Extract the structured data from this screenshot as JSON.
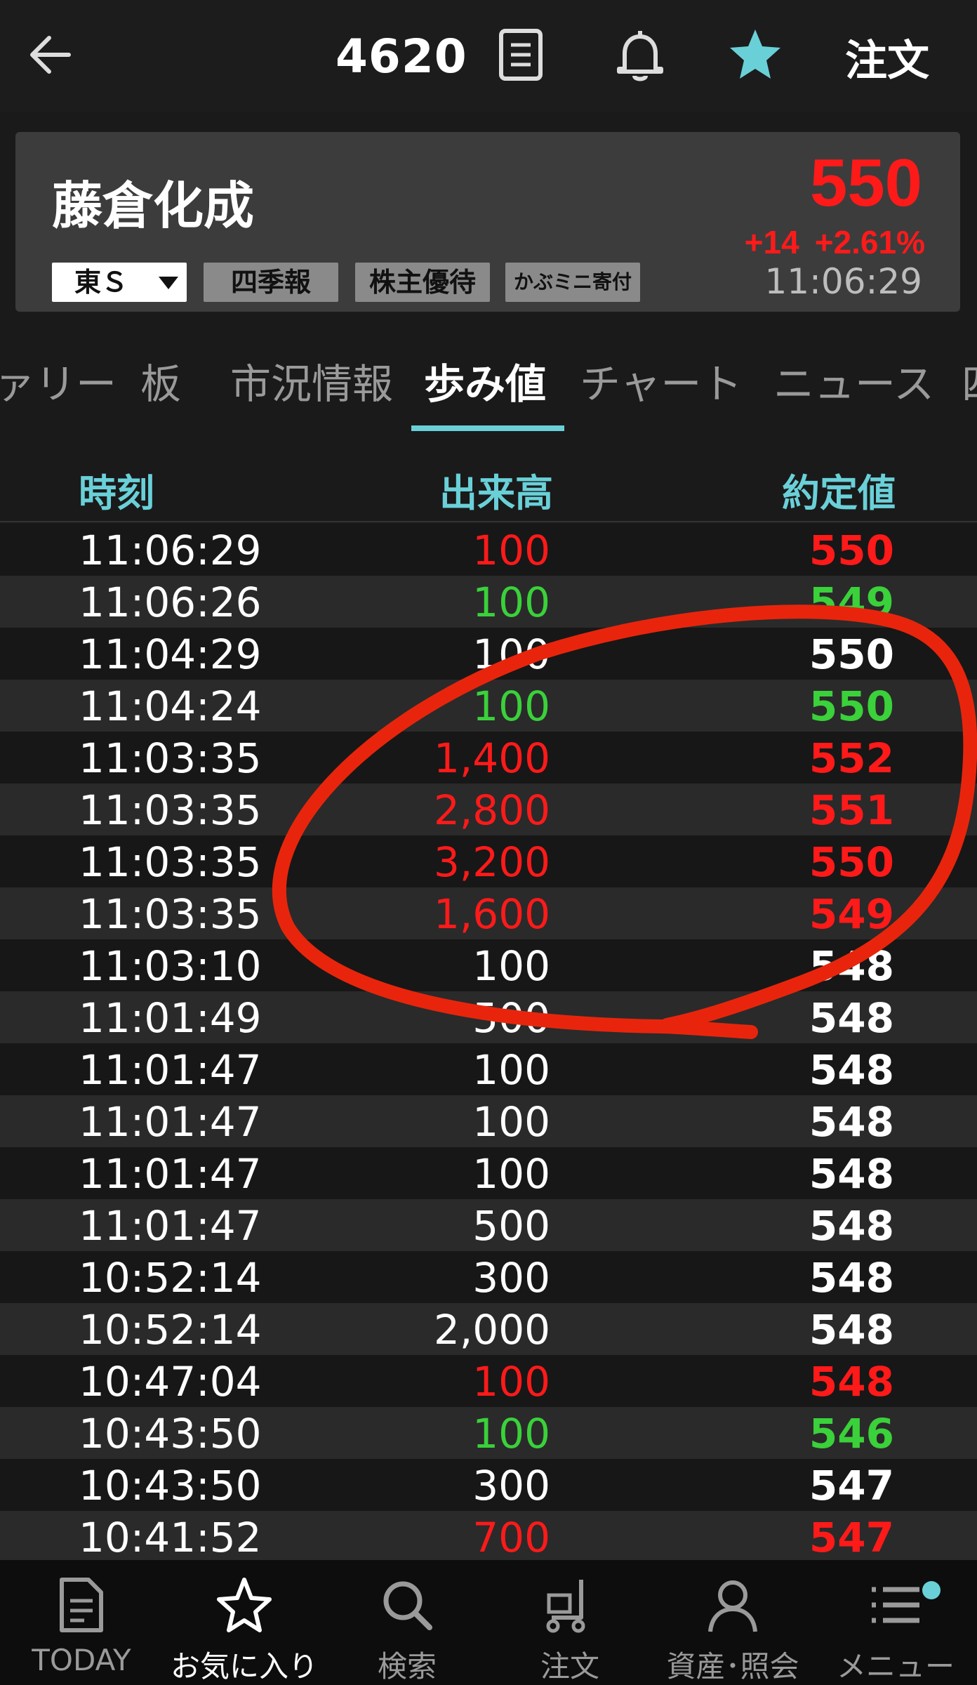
{
  "header": {
    "ticker_code": "4620",
    "order_label": "注文"
  },
  "stock": {
    "name": "藤倉化成",
    "price": "550",
    "change": "+14",
    "change_pct": "+2.61%",
    "time": "11:06:29",
    "market": "東Ｓ",
    "tags": [
      "四季報",
      "株主優待",
      "かぶミニ寄付"
    ]
  },
  "tabs": [
    "ァリー",
    "板",
    "市況情報",
    "歩み値",
    "チャート",
    "ニュース",
    "四"
  ],
  "active_tab": "歩み値",
  "table": {
    "headers": {
      "time": "時刻",
      "volume": "出来高",
      "price": "約定値"
    },
    "rows": [
      {
        "time": "11:06:29",
        "volume": "100",
        "price": "550",
        "color": "red"
      },
      {
        "time": "11:06:26",
        "volume": "100",
        "price": "549",
        "color": "green"
      },
      {
        "time": "11:04:29",
        "volume": "100",
        "price": "550",
        "color": "white"
      },
      {
        "time": "11:04:24",
        "volume": "100",
        "price": "550",
        "color": "green"
      },
      {
        "time": "11:03:35",
        "volume": "1,400",
        "price": "552",
        "color": "red"
      },
      {
        "time": "11:03:35",
        "volume": "2,800",
        "price": "551",
        "color": "red"
      },
      {
        "time": "11:03:35",
        "volume": "3,200",
        "price": "550",
        "color": "red"
      },
      {
        "time": "11:03:35",
        "volume": "1,600",
        "price": "549",
        "color": "red"
      },
      {
        "time": "11:03:10",
        "volume": "100",
        "price": "548",
        "color": "white"
      },
      {
        "time": "11:01:49",
        "volume": "500",
        "price": "548",
        "color": "white"
      },
      {
        "time": "11:01:47",
        "volume": "100",
        "price": "548",
        "color": "white"
      },
      {
        "time": "11:01:47",
        "volume": "100",
        "price": "548",
        "color": "white"
      },
      {
        "time": "11:01:47",
        "volume": "100",
        "price": "548",
        "color": "white"
      },
      {
        "time": "11:01:47",
        "volume": "500",
        "price": "548",
        "color": "white"
      },
      {
        "time": "10:52:14",
        "volume": "300",
        "price": "548",
        "color": "white"
      },
      {
        "time": "10:52:14",
        "volume": "2,000",
        "price": "548",
        "color": "white"
      },
      {
        "time": "10:47:04",
        "volume": "100",
        "price": "548",
        "color": "red"
      },
      {
        "time": "10:43:50",
        "volume": "100",
        "price": "546",
        "color": "green"
      },
      {
        "time": "10:43:50",
        "volume": "300",
        "price": "547",
        "color": "white"
      },
      {
        "time": "10:41:52",
        "volume": "700",
        "price": "547",
        "color": "red"
      }
    ]
  },
  "bottom_nav": [
    {
      "label": "TODAY",
      "icon": "document-icon"
    },
    {
      "label": "お気に入り",
      "icon": "star-outline-icon"
    },
    {
      "label": "検索",
      "icon": "search-icon"
    },
    {
      "label": "注文",
      "icon": "cart-icon"
    },
    {
      "label": "資産･照会",
      "icon": "person-icon"
    },
    {
      "label": "メニュー",
      "icon": "menu-icon"
    }
  ],
  "colors": {
    "accent": "#6ad0d8",
    "up": "#ff1a1a",
    "down": "#3ad13a",
    "annotation": "#e8250c"
  }
}
